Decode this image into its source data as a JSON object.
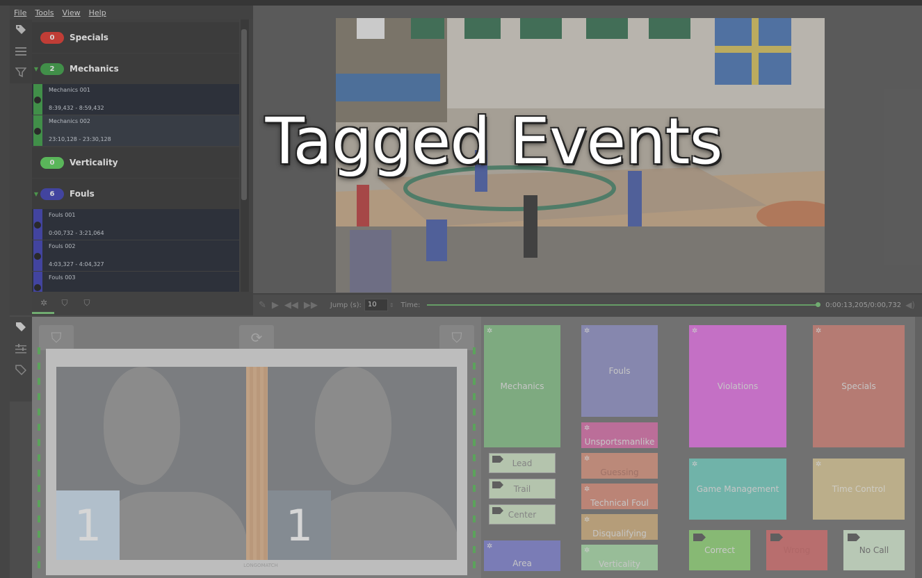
{
  "menu": [
    "File",
    "Tools",
    "View",
    "Help"
  ],
  "sidebar_icons": [
    "tag-icon",
    "list-icon",
    "filter-icon"
  ],
  "categories": [
    {
      "name": "Specials",
      "count": "0",
      "color": "#e0241b",
      "expanded": false
    },
    {
      "name": "Mechanics",
      "count": "2",
      "color": "#2a9a35",
      "expanded": true,
      "events": [
        {
          "name": "Mechanics 001",
          "time": "8:39,432 - 8:59,432"
        },
        {
          "name": "Mechanics 002",
          "time": "23:10,128 - 23:30,128"
        }
      ]
    },
    {
      "name": "Verticality",
      "count": "0",
      "color": "#4ed24e",
      "expanded": false
    },
    {
      "name": "Fouls",
      "count": "6",
      "color": "#2b2fb0",
      "expanded": true,
      "events": [
        {
          "name": "Fouls 001",
          "time": "0:00,732 - 3:21,064"
        },
        {
          "name": "Fouls 002",
          "time": "4:03,327 - 4:04,327"
        },
        {
          "name": "Fouls 003",
          "time": ""
        }
      ]
    }
  ],
  "player": {
    "jump_label": "Jump (s):",
    "jump_value": "10",
    "time_label": "Time:",
    "time_readout": "0:00:13,205/0:00,732"
  },
  "overlay_title": "Tagged Events",
  "field": {
    "left_number": "1",
    "right_number": "1",
    "logo_text": "LONGOMATCH"
  },
  "buttons": {
    "mechanics": "Mechanics",
    "fouls": "Fouls",
    "unsportsmanlike": "Unsportsmanlike",
    "guessing": "Guessing",
    "technical_foul": "Technical Foul",
    "disqualifying": "Disqualifying",
    "verticality": "Verticality",
    "violations": "Violations",
    "specials": "Specials",
    "game_management": "Game Management",
    "time_control": "Time Control",
    "area": "Area",
    "lead": "Lead",
    "trail": "Trail",
    "center": "Center",
    "correct": "Correct",
    "wrong": "Wrong",
    "no_call": "No Call"
  },
  "colors": {
    "mechanics": "#82c085",
    "fouls": "#8d8fc6",
    "unsportsmanlike": "#d96aa8",
    "guessing": "#d8917a",
    "technical_foul": "#d98a76",
    "disqualifying": "#d0ae7a",
    "verticality": "#a6dca6",
    "violations": "#e56de7",
    "specials": "#d07d71",
    "game_management": "#6ecdbf",
    "time_control": "#d8c693",
    "area": "#7c7fd2",
    "correct": "#8fd673",
    "wrong": "#d46a6a",
    "no_call": "#d4ebd0"
  }
}
